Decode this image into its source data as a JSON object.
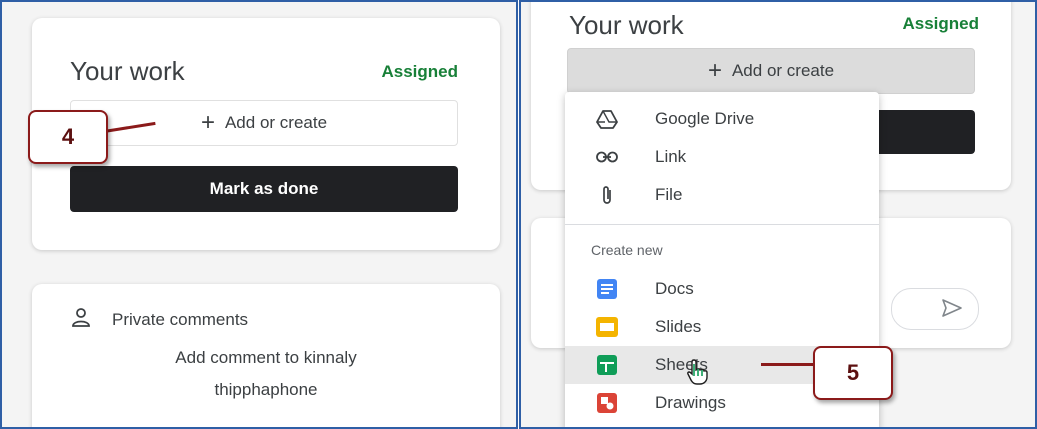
{
  "left": {
    "title": "Your work",
    "status": "Assigned",
    "add_label": "Add or create",
    "mark_done_label": "Mark as done",
    "callout": "4",
    "comments": {
      "heading": "Private comments",
      "add_comment_line1": "Add comment to kinnaly",
      "add_comment_line2": "thipphaphone",
      "icon": "person-icon"
    }
  },
  "right": {
    "title": "Your work",
    "status": "Assigned",
    "add_label": "Add or create",
    "callout": "5",
    "menu": {
      "items": [
        {
          "label": "Google Drive",
          "icon": "google-drive-icon"
        },
        {
          "label": "Link",
          "icon": "link-icon"
        },
        {
          "label": "File",
          "icon": "paperclip-icon"
        }
      ],
      "create_new_label": "Create new",
      "create_items": [
        {
          "label": "Docs",
          "icon": "docs-icon",
          "color": "#4285f4"
        },
        {
          "label": "Slides",
          "icon": "slides-icon",
          "color": "#f4b400"
        },
        {
          "label": "Sheets",
          "icon": "sheets-icon",
          "color": "#0f9d58"
        },
        {
          "label": "Drawings",
          "icon": "drawings-icon",
          "color": "#db4437"
        }
      ]
    }
  },
  "colors": {
    "assigned_green": "#188038",
    "callout_border": "#8b1a1a",
    "panel_border": "#2f5fa6"
  }
}
